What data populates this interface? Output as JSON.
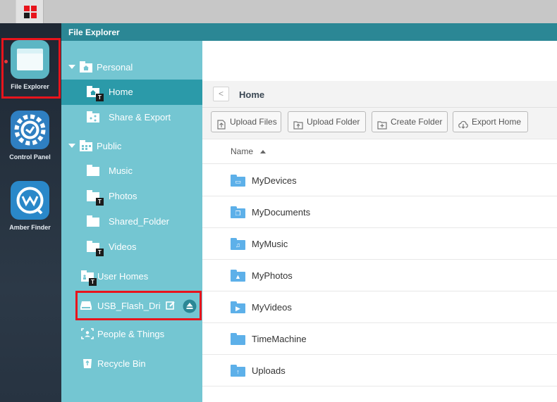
{
  "window": {
    "title": "File Explorer"
  },
  "dock": {
    "apps": [
      {
        "label": "File Explorer",
        "icon": "file-explorer-icon",
        "selected": true
      },
      {
        "label": "Control Panel",
        "icon": "control-panel-icon"
      },
      {
        "label": "Amber Finder",
        "icon": "amber-finder-icon"
      }
    ]
  },
  "sidebar": {
    "personal": {
      "label": "Personal"
    },
    "home": {
      "label": "Home"
    },
    "share_export": {
      "label": "Share & Export"
    },
    "public": {
      "label": "Public"
    },
    "music": {
      "label": "Music"
    },
    "photos": {
      "label": "Photos"
    },
    "shared_folder": {
      "label": "Shared_Folder"
    },
    "videos": {
      "label": "Videos"
    },
    "user_homes": {
      "label": "User Homes"
    },
    "usb": {
      "label": "USB_Flash_Driv"
    },
    "people_things": {
      "label": "People & Things"
    },
    "recycle_bin": {
      "label": "Recycle Bin"
    },
    "badge": "T"
  },
  "breadcrumb": {
    "back": "<",
    "current": "Home"
  },
  "toolbar": {
    "upload_files": "Upload Files",
    "upload_folder": "Upload Folder",
    "create_folder": "Create Folder",
    "export_home": "Export Home"
  },
  "table": {
    "column_name": "Name",
    "rows": [
      {
        "name": "MyDevices",
        "glyph": "▭"
      },
      {
        "name": "MyDocuments",
        "glyph": "❐"
      },
      {
        "name": "MyMusic",
        "glyph": "♫"
      },
      {
        "name": "MyPhotos",
        "glyph": "▲"
      },
      {
        "name": "MyVideos",
        "glyph": "▶"
      },
      {
        "name": "TimeMachine",
        "glyph": ""
      },
      {
        "name": "Uploads",
        "glyph": "↑"
      }
    ]
  },
  "colors": {
    "accent": "#2b8795",
    "sidebar": "#74c6d2",
    "sidebar_active": "#2b9aa9",
    "folder": "#5db0e9",
    "highlight": "#e8141c"
  }
}
